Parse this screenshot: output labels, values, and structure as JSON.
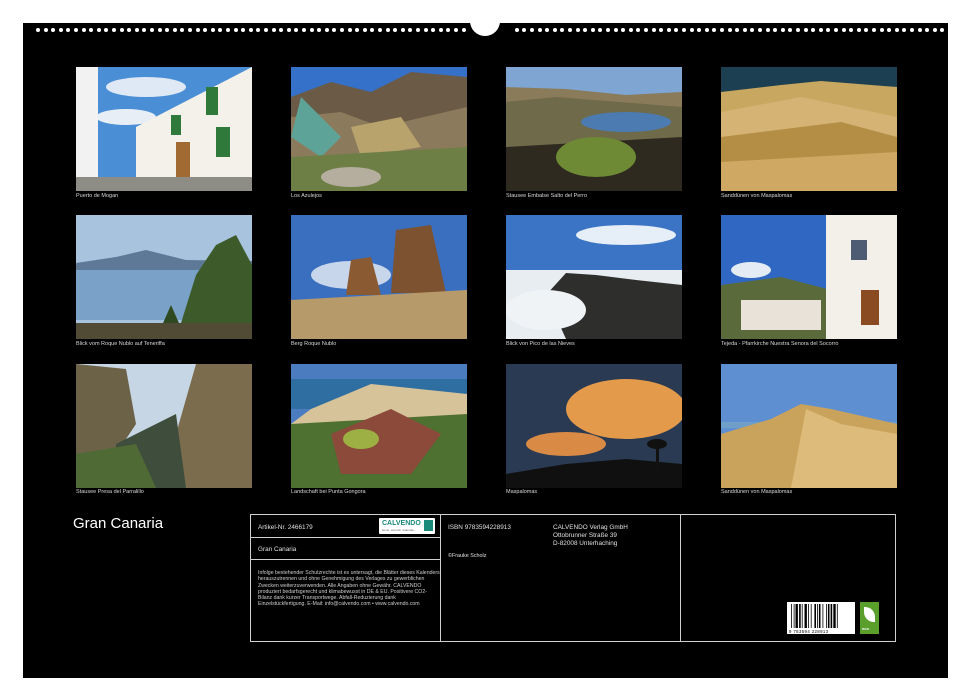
{
  "title": "Gran Canaria",
  "photos": [
    {
      "caption": "Puerto de Mogan"
    },
    {
      "caption": "Los Azulejos"
    },
    {
      "caption": "Stausee Embalse Salto del Perro"
    },
    {
      "caption": "Sanddünen von Maspalomas"
    },
    {
      "caption": "Blick vom Roque Nublo auf Teneriffa"
    },
    {
      "caption": "Berg Roque Nublo"
    },
    {
      "caption": "Blick von Pico de las Nieves"
    },
    {
      "caption": "Tejeda - Pfarrkirche Nuestra Senora del Socorro"
    },
    {
      "caption": "Stausee Presa del Parralillo"
    },
    {
      "caption": "Landschaft bei Punta Gongora"
    },
    {
      "caption": "Maspalomas"
    },
    {
      "caption": "Sanddünen von Maspalomas"
    }
  ],
  "info": {
    "article": "Artikel-Nr. 2466179",
    "product_title": "Gran Canaria",
    "logo": "CALVENDO",
    "logo_sub": "kunst. wunsch. kalender.",
    "disclaimer": "Infolge bestehender Schutzrechte ist es untersagt, die Blätter dieses Kalenders herauszutrennen und ohne Genehmigung des Verlages zu gewerblichen Zwecken weiterzuverwenden. Alle Angaben ohne Gewähr. CALVENDO produziert bedarfsgerecht und klimabewusst in DE & EU. Positivere CO2-Bilanz dank kurzer Transportwege. Abfall-Reduzierung dank Einzelstückfertigung. E-Mail: info@calvendo.com • www.calvendo.com",
    "isbn": "ISBN 9783594228913",
    "author": "©Frauke Scholz",
    "publisher_name": "CALVENDO Verlag GmbH",
    "publisher_street": "Ottobrunner Straße 39",
    "publisher_city": "D-82008 Unterhaching",
    "barcode_number": "9 783594 228913",
    "eco_label": "eco"
  }
}
